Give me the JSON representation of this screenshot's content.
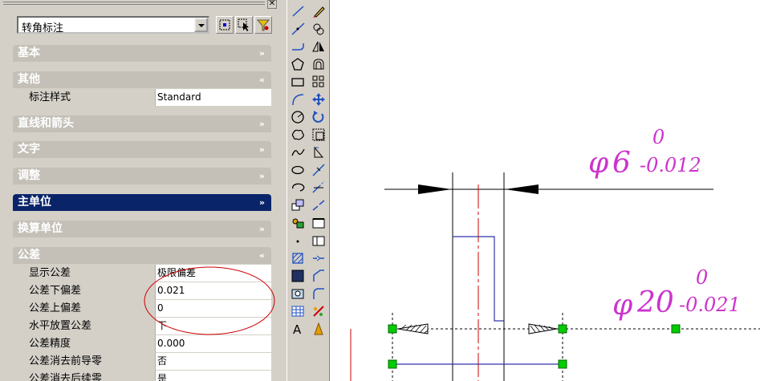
{
  "properties": {
    "object_type": "转角标注",
    "categories": {
      "basic": "基本",
      "misc": "其他",
      "lines_arrows": "直线和箭头",
      "text": "文字",
      "fit": "调整",
      "primary_units": "主单位",
      "alt_units": "换算单位",
      "tolerances": "公差"
    },
    "misc_rows": [
      {
        "name": "标注样式",
        "value": "Standard"
      }
    ],
    "tolerance_rows": [
      {
        "name": "显示公差",
        "value": "极限偏差"
      },
      {
        "name": "公差下偏差",
        "value": "0.021"
      },
      {
        "name": "公差上偏差",
        "value": "0"
      },
      {
        "name": "水平放置公差",
        "value": "下"
      },
      {
        "name": "公差精度",
        "value": "0.000"
      },
      {
        "name": "公差消去前导零",
        "value": "否"
      },
      {
        "name": "公差消去后续零",
        "value": "是"
      }
    ]
  },
  "toolbar_draw_icons": [
    "line-icon",
    "construction-line-icon",
    "polyline-icon",
    "polygon-icon",
    "rectangle-icon",
    "arc-icon",
    "circle-icon",
    "revision-cloud-icon",
    "spline-icon",
    "ellipse-icon",
    "ellipse-arc-icon",
    "insert-block-icon",
    "make-block-icon",
    "point-icon",
    "hatch-icon",
    "gradient-icon",
    "region-icon",
    "table-icon",
    "multiline-text-icon"
  ],
  "toolbar_modify_icons": [
    "erase-icon",
    "copy-icon",
    "mirror-icon",
    "offset-icon",
    "array-icon",
    "move-icon",
    "rotate-icon",
    "scale-icon",
    "stretch-icon",
    "trim-icon",
    "extend-icon",
    "break-at-point-icon",
    "break-icon",
    "join-icon",
    "chamfer-icon",
    "fillet-icon",
    "explode-icon",
    "properties-icon"
  ],
  "drawing": {
    "dim1": {
      "prefix": "φ",
      "nominal": "6",
      "upper": "0",
      "lower": "-0.012"
    },
    "dim2": {
      "prefix": "φ",
      "nominal": "20",
      "upper": "0",
      "lower": "-0.021"
    },
    "colors": {
      "dimension_text": "#cc33cc",
      "geometry": "#3333aa",
      "centerline": "#cc0000",
      "grip": "#00cc00",
      "annotation_circle": "#cc0000"
    }
  }
}
